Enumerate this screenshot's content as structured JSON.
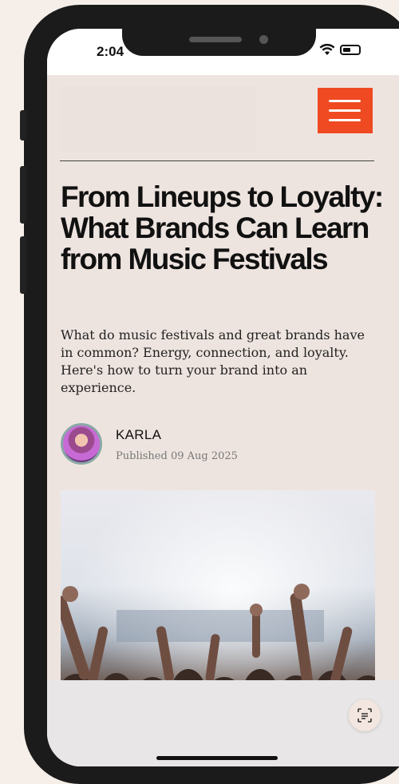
{
  "status_bar": {
    "time": "2:04",
    "icons": [
      "wifi-icon",
      "battery-icon"
    ]
  },
  "header": {
    "menu_icon": "hamburger-icon",
    "menu_color": "#f04a22"
  },
  "article": {
    "title": "From Lineups to Loyalty: What Brands Can Learn from Music Festivals",
    "subtitle": "What do music festivals and great brands have in common? Energy, connection, and loyalty. Here's how to turn your brand into an experience.",
    "author": "KARLA",
    "published": "Published 09 Aug 2025",
    "hero_image": "concert-crowd-image"
  },
  "floating": {
    "scan_icon": "scan-text-icon"
  }
}
